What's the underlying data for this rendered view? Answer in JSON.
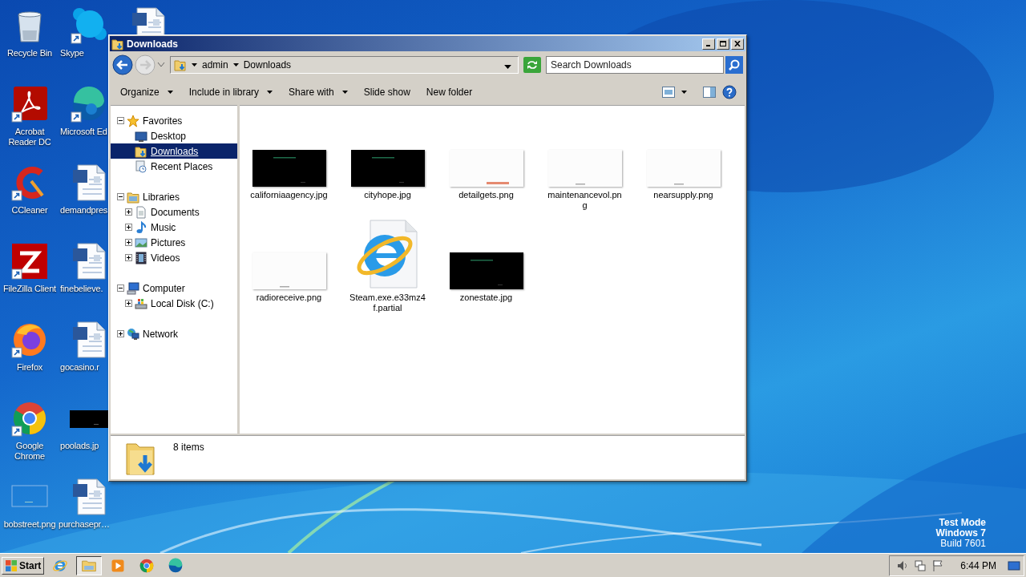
{
  "desktop_icons": [
    {
      "label": "Recycle Bin",
      "kind": "recycle-bin",
      "shortcut": false
    },
    {
      "label": "Acrobat Reader DC",
      "kind": "acrobat",
      "shortcut": true
    },
    {
      "label": "CCleaner",
      "kind": "ccleaner",
      "shortcut": true
    },
    {
      "label": "FileZilla Client",
      "kind": "filezilla",
      "shortcut": true
    },
    {
      "label": "Firefox",
      "kind": "firefox",
      "shortcut": true
    },
    {
      "label": "Google Chrome",
      "kind": "chrome",
      "shortcut": true
    },
    {
      "label": "bobstreet.png",
      "kind": "light-image",
      "shortcut": false
    },
    {
      "label": "Skype",
      "kind": "skype",
      "shortcut": true
    },
    {
      "label": "Microsoft Ed",
      "kind": "edge",
      "shortcut": true
    },
    {
      "label": "demandpres",
      "kind": "word",
      "shortcut": false
    },
    {
      "label": "finebelieve.",
      "kind": "word",
      "shortcut": false
    },
    {
      "label": "gocasino.r",
      "kind": "word",
      "shortcut": false
    },
    {
      "label": "poolads.jp",
      "kind": "dark-image",
      "shortcut": false
    },
    {
      "label": "purchasepr…",
      "kind": "word",
      "shortcut": false
    },
    {
      "kind": "word",
      "shortcut": false
    }
  ],
  "window": {
    "title": "Downloads"
  },
  "address": {
    "back_disabled": false,
    "forward_disabled": true,
    "path": [
      "admin",
      "Downloads"
    ],
    "search_placeholder": "Search Downloads"
  },
  "toolbar": [
    {
      "label": "Organize",
      "menu": true
    },
    {
      "label": "Include in library",
      "menu": true
    },
    {
      "label": "Share with",
      "menu": true
    },
    {
      "label": "Slide show",
      "menu": false
    },
    {
      "label": "New folder",
      "menu": false
    }
  ],
  "nav_tree": [
    {
      "label": "Favorites",
      "kind": "favorites",
      "expanded": true,
      "selected": false,
      "children": [
        {
          "label": "Desktop",
          "kind": "desktop",
          "selected": false
        },
        {
          "label": "Downloads",
          "kind": "downloads",
          "selected": true
        },
        {
          "label": "Recent Places",
          "kind": "recent",
          "selected": false
        }
      ]
    },
    {
      "label": "Libraries",
      "kind": "libraries",
      "expanded": true,
      "selected": false,
      "children": [
        {
          "label": "Documents",
          "kind": "documents",
          "expanded": false,
          "selected": false
        },
        {
          "label": "Music",
          "kind": "music",
          "expanded": false,
          "selected": false
        },
        {
          "label": "Pictures",
          "kind": "pictures",
          "expanded": false,
          "selected": false
        },
        {
          "label": "Videos",
          "kind": "videos",
          "expanded": false,
          "selected": false
        }
      ]
    },
    {
      "label": "Computer",
      "kind": "computer",
      "expanded": true,
      "selected": false,
      "children": [
        {
          "label": "Local Disk (C:)",
          "kind": "disk",
          "expanded": false,
          "selected": false
        }
      ]
    },
    {
      "label": "Network",
      "kind": "network",
      "expanded": false,
      "selected": false
    }
  ],
  "files": [
    {
      "name": "californiaagency.jpg",
      "kind": "dark"
    },
    {
      "name": "cityhope.jpg",
      "kind": "dark"
    },
    {
      "name": "detailgets.png",
      "kind": "redmark"
    },
    {
      "name": "maintenancevol.png",
      "kind": "light"
    },
    {
      "name": "nearsupply.png",
      "kind": "light"
    },
    {
      "name": "radioreceive.png",
      "kind": "light"
    },
    {
      "name": "Steam.exe.e33mz4f.partial",
      "kind": "program"
    },
    {
      "name": "zonestate.jpg",
      "kind": "dark"
    }
  ],
  "status": {
    "text": "8 items"
  },
  "watermark": [
    "Test Mode",
    "Windows 7",
    "Build 7601"
  ],
  "taskbar": {
    "start": "Start",
    "apps": [
      {
        "kind": "ie",
        "selected": false
      },
      {
        "kind": "explorer",
        "selected": true
      },
      {
        "kind": "media",
        "selected": false
      },
      {
        "kind": "chrome",
        "selected": false
      },
      {
        "kind": "edge",
        "selected": false
      }
    ],
    "clock": "6:44 PM"
  }
}
